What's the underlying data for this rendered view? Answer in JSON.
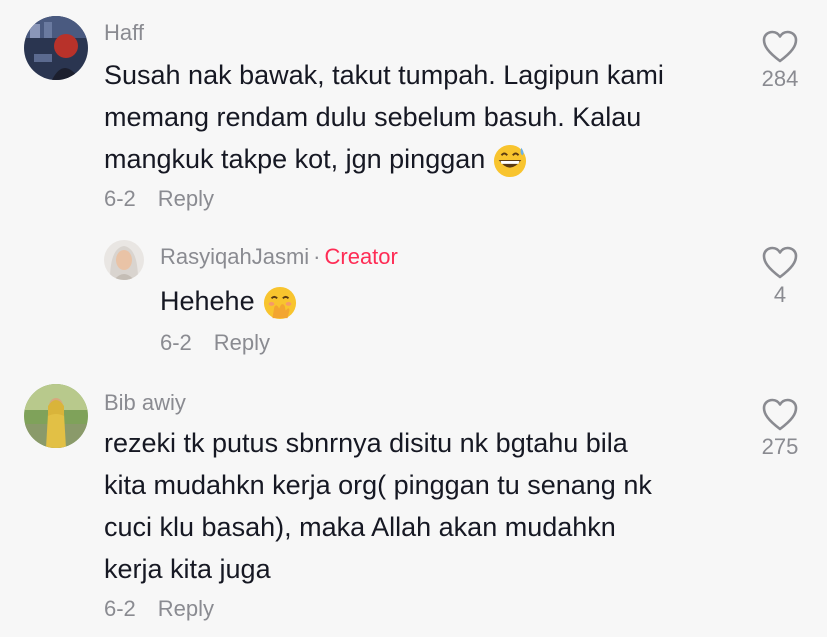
{
  "comments": [
    {
      "username": "Haff",
      "text_lines": [
        "Susah nak bawak, takut tumpah. Lagipun kami",
        "memang rendam dulu sebelum basuh. Kalau",
        "mangkuk takpe kot, jgn pinggan"
      ],
      "emoji": "grinning-sweat-emoji",
      "date": "6-2",
      "reply_label": "Reply",
      "like_count": "284"
    },
    {
      "username": "RasyiqahJasmi",
      "separator": "·",
      "badge": "Creator",
      "text_lines": [
        "Hehehe"
      ],
      "emoji": "hand-over-mouth-emoji",
      "date": "6-2",
      "reply_label": "Reply",
      "like_count": "4"
    },
    {
      "username": "Bib awiy",
      "text_lines": [
        "rezeki tk putus sbnrnya disitu nk bgtahu bila",
        "kita mudahkn kerja org( pinggan tu senang nk",
        "cuci klu basah), maka Allah akan mudahkn",
        "kerja kita juga"
      ],
      "date": "6-2",
      "reply_label": "Reply",
      "like_count": "275"
    }
  ],
  "colors": {
    "background": "#f7f7f7",
    "text": "#161823",
    "muted": "#8a8b91",
    "creator": "#fe2c55"
  }
}
